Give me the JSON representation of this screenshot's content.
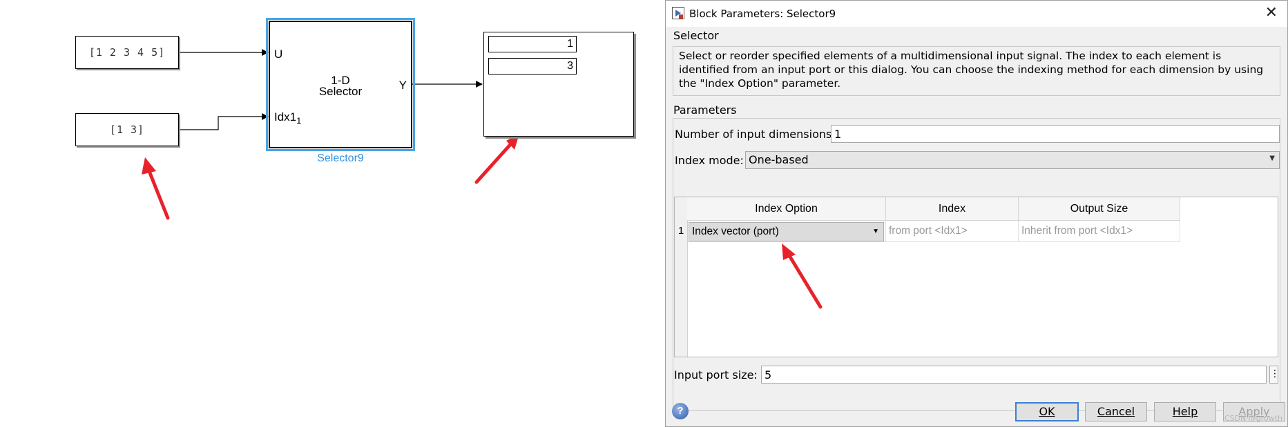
{
  "canvas": {
    "constant1_label": "[1 2 3 4 5]",
    "constant2_label": "[1 3]",
    "selector": {
      "port_u": "U",
      "port_idx": "Idx1",
      "port_idx_sub": "1",
      "port_y": "Y",
      "title_line1": "1-D",
      "title_line2": "Selector",
      "name": "Selector9"
    },
    "display": {
      "rows": [
        "1",
        "3"
      ]
    }
  },
  "dialog": {
    "title": "Block Parameters: Selector9",
    "block_type": "Selector",
    "description": "Select or reorder specified elements of a multidimensional input signal. The index to each element is identified from an input port or this dialog. You can choose the indexing method for each dimension by using the \"Index Option\" parameter.",
    "parameters_heading": "Parameters",
    "num_dims_label": "Number of input dimensions:",
    "num_dims_value": "1",
    "index_mode_label": "Index mode:",
    "index_mode_value": "One-based",
    "table": {
      "headers": [
        "Index Option",
        "Index",
        "Output Size"
      ],
      "rows": [
        {
          "num": "1",
          "option": "Index vector (port)",
          "index": "from port <Idx1>",
          "output_size": "Inherit from port <Idx1>"
        }
      ]
    },
    "port_size_label": "Input port size:",
    "port_size_value": "5",
    "buttons": {
      "ok": "OK",
      "cancel": "Cancel",
      "help": "Help",
      "apply": "Apply"
    },
    "watermark": "CSDN @growth"
  },
  "colors": {
    "selection": "#49a6e8",
    "block_name": "#2b93e0",
    "arrow": "#e8222b",
    "dialog_bg": "#f0f0f0"
  }
}
